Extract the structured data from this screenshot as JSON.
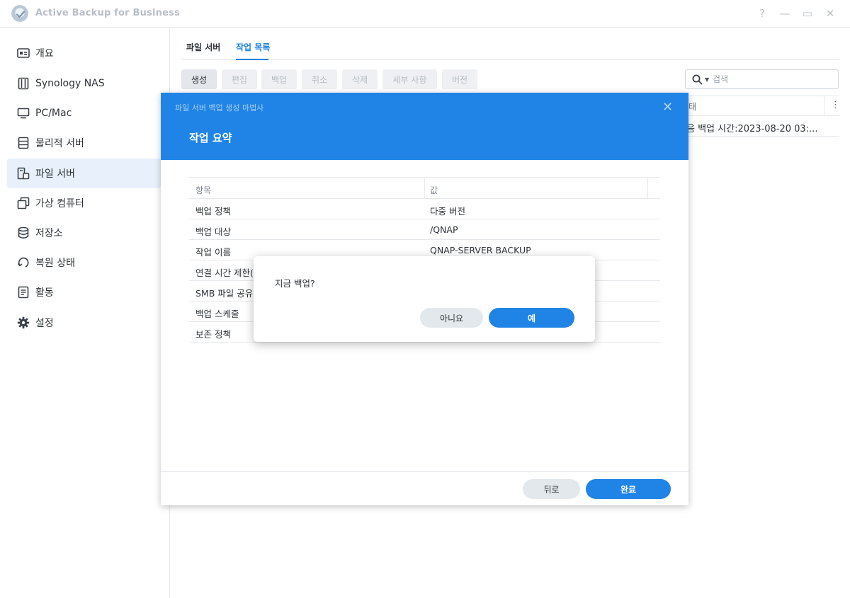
{
  "window": {
    "title": "Active Backup for Business",
    "help_label": "?",
    "minimize_label": "—",
    "maximize_label": "▭",
    "close_label": "✕"
  },
  "sidebar": {
    "items": [
      {
        "label": "개요",
        "icon": "overview-icon"
      },
      {
        "label": "Synology NAS",
        "icon": "nas-icon"
      },
      {
        "label": "PC/Mac",
        "icon": "pc-mac-icon"
      },
      {
        "label": "물리적 서버",
        "icon": "physical-server-icon"
      },
      {
        "label": "파일 서버",
        "icon": "file-server-icon",
        "active": true
      },
      {
        "label": "가상 컴퓨터",
        "icon": "virtual-machine-icon"
      },
      {
        "label": "저장소",
        "icon": "storage-icon"
      },
      {
        "label": "복원 상태",
        "icon": "restore-status-icon"
      },
      {
        "label": "활동",
        "icon": "activity-icon"
      },
      {
        "label": "설정",
        "icon": "gear-icon"
      }
    ]
  },
  "tabs": [
    {
      "label": "파일 서버"
    },
    {
      "label": "작업 목록",
      "active": true
    }
  ],
  "toolbar": {
    "create": "생성",
    "edit": "편집",
    "backup": "백업",
    "cancel": "취소",
    "delete": "삭제",
    "details": "세부 사항",
    "version": "버전"
  },
  "search": {
    "placeholder": "검색"
  },
  "grid": {
    "status_header": "태",
    "rows": [
      {
        "status": "음 백업 시간:2023-08-20 03:..."
      }
    ]
  },
  "wizard": {
    "title": "파일 서버 백업 생성 마법사",
    "heading": "작업 요약",
    "columns": {
      "item": "항목",
      "value": "값"
    },
    "rows": [
      {
        "key": "백업 정책",
        "value": "다중 버전"
      },
      {
        "key": "백업 대상",
        "value": "/QNAP"
      },
      {
        "key": "작업 이름",
        "value": "QNAP-SERVER BACKUP"
      },
      {
        "key": "연결 시간 제한(",
        "value": ""
      },
      {
        "key": "SMB 파일 공유",
        "value": ""
      },
      {
        "key": "백업 스케줄",
        "value": ""
      },
      {
        "key": "보존 정책",
        "value": ""
      }
    ],
    "back_label": "뒤로",
    "finish_label": "완료",
    "close_label": "✕"
  },
  "confirm": {
    "message": "지금 백업?",
    "no_label": "아니요",
    "yes_label": "예"
  },
  "colors": {
    "accent": "#1f84e5",
    "sidebar_active_bg": "#e8f1fb"
  }
}
